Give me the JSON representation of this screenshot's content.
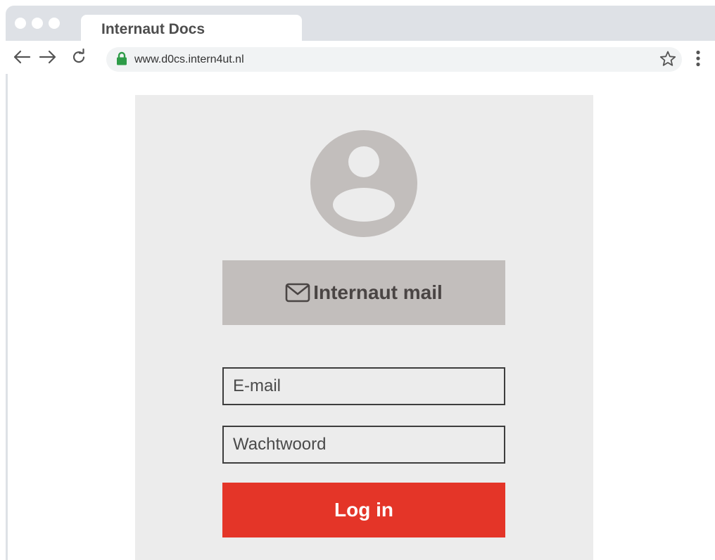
{
  "browser": {
    "tab_title": "Internaut Docs",
    "url": "www.d0cs.intern4ut.nl",
    "icons": {
      "back": "arrow-left-icon",
      "forward": "arrow-right-icon",
      "reload": "reload-icon",
      "lock": "lock-icon",
      "bookmark": "star-icon",
      "menu": "three-dots-vertical-icon"
    }
  },
  "login": {
    "avatar_icon": "user-avatar-icon",
    "mail_button": {
      "icon": "envelope-icon",
      "label": "Internaut mail"
    },
    "email_placeholder": "E-mail",
    "password_placeholder": "Wachtwoord",
    "login_label": "Log in"
  },
  "colors": {
    "chrome": "#dee1e6",
    "card": "#ececec",
    "mail_button": "#c2bebc",
    "login_button": "#e43528",
    "lock": "#2e9c48"
  }
}
